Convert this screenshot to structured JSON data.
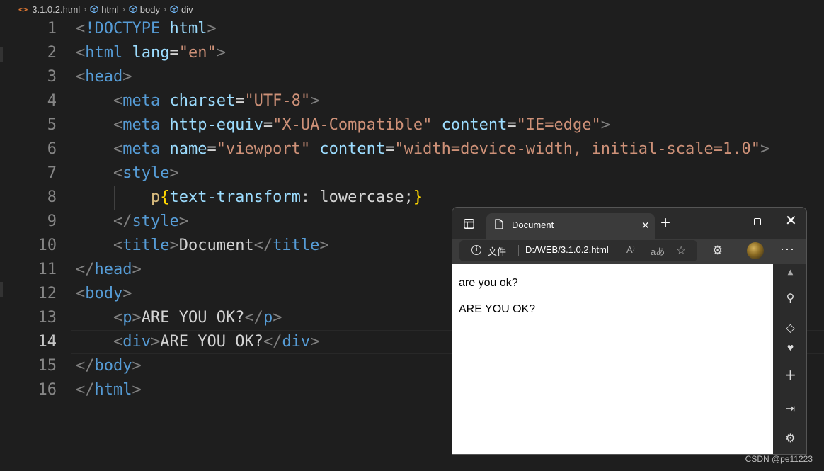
{
  "breadcrumb": {
    "file": "3.1.0.2.html",
    "items": [
      "html",
      "body",
      "div"
    ],
    "file_icon_glyph": "<>"
  },
  "editor": {
    "line_numbers": [
      "1",
      "2",
      "3",
      "4",
      "5",
      "6",
      "7",
      "8",
      "9",
      "10",
      "11",
      "12",
      "13",
      "14",
      "15",
      "16"
    ],
    "active_line": "14",
    "tokens": {
      "l1_doctype": "!DOCTYPE",
      "l1_html": "html",
      "l2_tag": "html",
      "l2_attr": "lang",
      "l2_val": "\"en\"",
      "l3_tag": "head",
      "l4_tag": "meta",
      "l4_attr": "charset",
      "l4_val": "\"UTF-8\"",
      "l5_tag": "meta",
      "l5_attr1": "http-equiv",
      "l5_val1": "\"X-UA-Compatible\"",
      "l5_attr2": "content",
      "l5_val2": "\"IE=edge\"",
      "l6_tag": "meta",
      "l6_attr1": "name",
      "l6_val1": "\"viewport\"",
      "l6_attr2": "content",
      "l6_val2": "\"width=device-width, initial-scale=1.0\"",
      "l7_tag": "style",
      "l8_sel": "p",
      "l8_prop": "text-transform",
      "l8_value": " lowercase;",
      "l9_tag": "style",
      "l10_tag": "title",
      "l10_text": "Document",
      "l11_tag": "head",
      "l12_tag": "body",
      "l13_tag": "p",
      "l13_text": "ARE YOU OK?",
      "l14_tag": "div",
      "l14_text": "ARE YOU OK?",
      "l15_tag": "body",
      "l16_tag": "html"
    }
  },
  "browser": {
    "tab_title": "Document",
    "address_label": "文件",
    "url": "D:/WEB/3.1.0.2.html",
    "read_aloud_glyph": "A⁾",
    "translate_glyph": "aあ",
    "page": {
      "p_text": "are you ok?",
      "div_text": "ARE YOU OK?"
    },
    "icons": [
      "tab-actions-icon",
      "document-icon",
      "close-icon",
      "new-tab-icon",
      "minimize-icon",
      "maximize-icon",
      "window-close-icon",
      "info-icon",
      "read-aloud-icon",
      "translate-icon",
      "add-favorite-icon",
      "extensions-icon",
      "profile-avatar",
      "more-icon",
      "scroll-up-icon",
      "search-icon",
      "tag-icon",
      "heart-icon",
      "add-icon",
      "split-screen-icon",
      "settings-icon"
    ]
  },
  "watermark": "CSDN @pe11223",
  "colors": {
    "editor_bg": "#1e1e1e",
    "tag": "#569cd6",
    "attr": "#9cdcfe",
    "string": "#ce9178",
    "bracket": "#808080",
    "brace": "#ffd700",
    "selector": "#d7ba7d",
    "browser_chrome": "#2b2b2b",
    "browser_tab": "#3b3b3b"
  }
}
